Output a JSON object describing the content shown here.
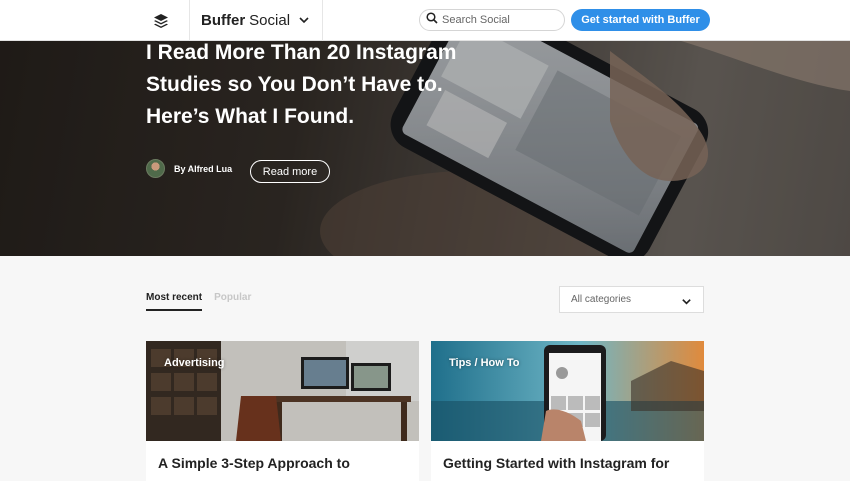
{
  "header": {
    "brand_bold": "Buffer",
    "brand_light": "Social",
    "search_placeholder": "Search Social",
    "cta_label": "Get started with Buffer"
  },
  "hero": {
    "title_lines": [
      "I Read More Than 20 Instagram",
      "Studies so You Don’t Have to.",
      "Here’s What I Found."
    ],
    "author": "By Alfred Lua",
    "read_more": "Read more"
  },
  "filters": {
    "tabs": [
      "Most recent",
      "Popular"
    ],
    "category_select": "All categories"
  },
  "cards": [
    {
      "tag": "Advertising",
      "title": "A Simple 3-Step Approach to"
    },
    {
      "tag": "Tips / How To",
      "title": "Getting Started with Instagram for"
    }
  ],
  "colors": {
    "accent": "#2f8fe8",
    "background": "#f7f7f7"
  },
  "icons": [
    "buffer-logo-icon",
    "chevron-down-icon",
    "search-icon"
  ]
}
